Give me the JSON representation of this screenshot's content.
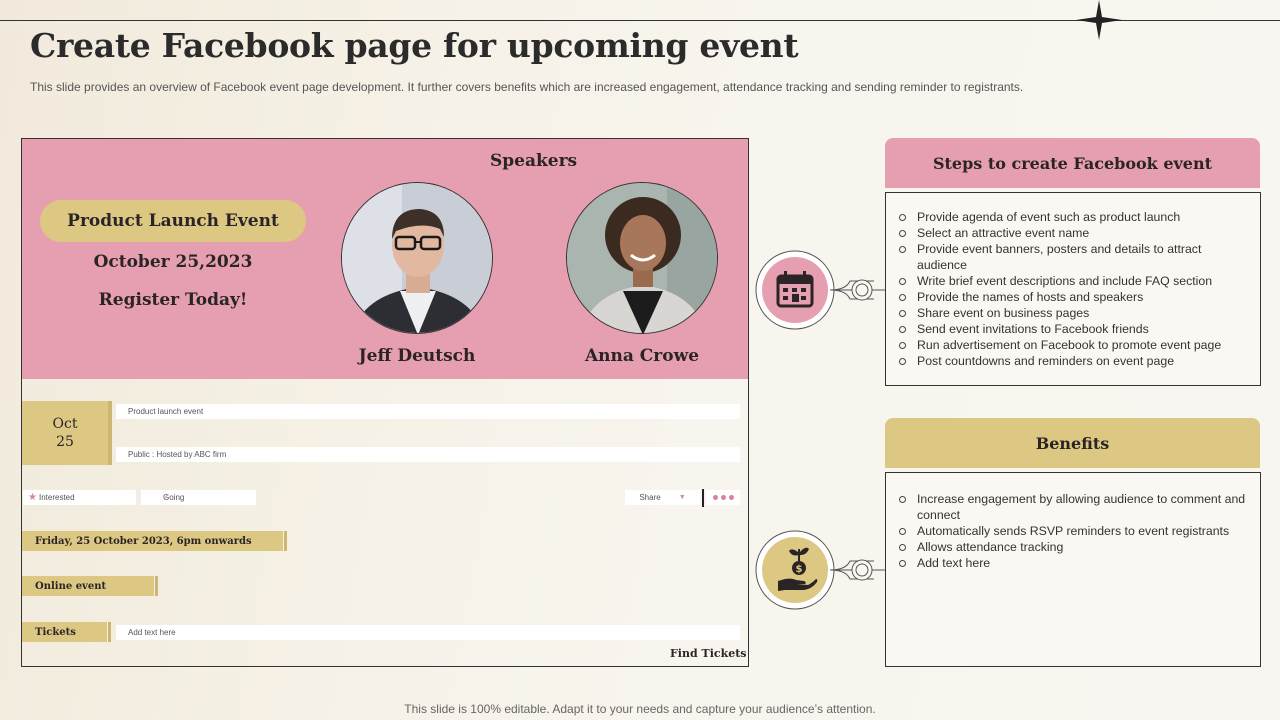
{
  "title": "Create Facebook page for upcoming event",
  "subtitle": "This slide provides an overview of Facebook event page development. It further covers benefits which are increased engagement, attendance tracking and sending reminder to registrants.",
  "footer": "This slide is 100% editable. Adapt it to your needs and capture your audience’s attention.",
  "event": {
    "pill": "Product Launch Event",
    "date": "October 25,2023",
    "register": "Register Today!",
    "speakers_heading": "Speakers",
    "speakers": [
      {
        "name": "Jeff Deutsch"
      },
      {
        "name": "Anna Crowe"
      }
    ],
    "date_box": {
      "month": "Oct",
      "day": "25"
    },
    "name_field": "Product launch event",
    "host_field": "Public : Hosted by ABC firm",
    "interested": "Interested",
    "going": "Going",
    "share": "Share",
    "datetime": "Friday, 25 October 2023, 6pm onwards",
    "location": "Online event",
    "tickets_label": "Tickets",
    "tickets_field": "Add text here",
    "find_tickets": "Find Tickets",
    "colors": {
      "pink": "#e59fb0",
      "gold": "#dcc783"
    },
    "icons": [
      "star-icon",
      "checkmark-icon",
      "caret-down-icon",
      "more-dots-icon"
    ]
  },
  "steps": {
    "heading": "Steps to create Facebook event",
    "icon": "calendar-icon",
    "items": [
      "Provide  agenda of event  such as product launch",
      "Select an attractive event  name",
      "Provide  event banners, posters and details to attract audience",
      "Write brief event descriptions and include FAQ section",
      "Provide  the names of hosts and speakers",
      "Share event  on business pages",
      "Send event invitations to Facebook friends",
      "Run advertisement  on Facebook to promote event  page",
      "Post countdowns  and reminders  on event page"
    ]
  },
  "benefits": {
    "heading": "Benefits",
    "icon": "money-plant-hand-icon",
    "items": [
      "Increase engagement  by allowing audience to comment and connect",
      "Automatically sends RSVP reminders to event registrants",
      "Allows attendance tracking",
      "Add text here"
    ]
  }
}
